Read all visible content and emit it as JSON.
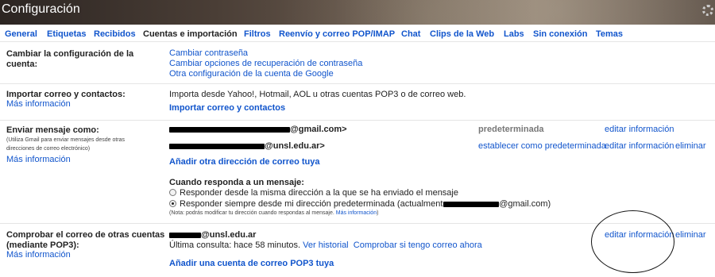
{
  "header": {
    "title": "Configuración"
  },
  "tabs": [
    {
      "label": "General"
    },
    {
      "label": "Etiquetas"
    },
    {
      "label": "Recibidos"
    },
    {
      "label": "Cuentas e importación"
    },
    {
      "label": "Filtros"
    },
    {
      "label": "Reenvío y correo POP/IMAP"
    },
    {
      "label": "Chat"
    },
    {
      "label": "Clips de la Web"
    },
    {
      "label": "Labs"
    },
    {
      "label": "Sin conexión"
    },
    {
      "label": "Temas"
    }
  ],
  "change_account": {
    "label": "Cambiar la configuración de la cuenta:",
    "links": [
      "Cambiar contraseña",
      "Cambiar opciones de recuperación de contraseña",
      "Otra configuración de la cuenta de Google"
    ]
  },
  "import": {
    "label": "Importar correo y contactos:",
    "more_info": "Más información",
    "text": "Importa desde Yahoo!, Hotmail, AOL u otras cuentas POP3 o de correo web.",
    "action": "Importar correo y contactos"
  },
  "send_as": {
    "label": "Enviar mensaje como:",
    "note": "(Utiliza Gmail para enviar mensajes desde otras direcciones de correo electrónico)",
    "more_info": "Más información",
    "address1_suffix": "@gmail.com>",
    "address1_status": "predeterminada",
    "address1_edit": "editar información",
    "address2_suffix": "@unsl.edu.ar>",
    "address2_set_default": "establecer como predeterminada",
    "address2_edit": "editar información",
    "address2_delete": "eliminar",
    "add_address": "Añadir otra dirección de correo tuya",
    "reply_heading": "Cuando responda a un mensaje:",
    "reply_option1": "Responder desde la misma dirección a la que se ha enviado el mensaje",
    "reply_option2_prefix": "Responder siempre desde mi dirección predeterminada (actualmente es",
    "reply_option2_suffix": "@gmail.com)",
    "reply_note": "(Nota: podrás modificar tu dirección cuando respondas al mensaje.",
    "reply_note_link": "Más información",
    "reply_note_close": ")"
  },
  "pop3": {
    "label": "Comprobar el correo de otras cuentas (mediante POP3):",
    "more_info": "Más información",
    "address_suffix": "@unsl.edu.ar",
    "last_check": "Última consulta: hace 58 minutos.",
    "history": "Ver historial",
    "check_now": "Comprobar si tengo correo ahora",
    "edit": "editar información",
    "delete": "eliminar",
    "add_account": "Añadir una cuenta de correo POP3 tuya"
  }
}
